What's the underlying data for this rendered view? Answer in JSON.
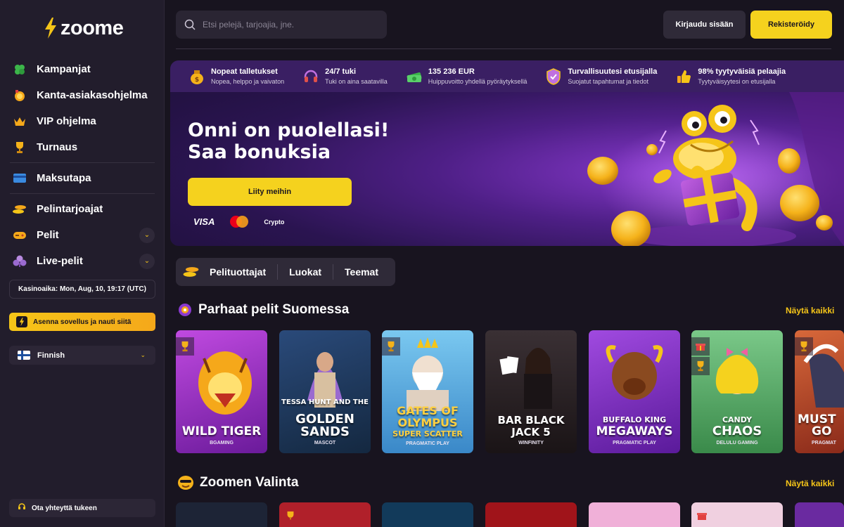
{
  "logo": {
    "text": "zoome"
  },
  "sidebar": {
    "items": [
      {
        "label": "Kampanjat",
        "icon": "clover-icon"
      },
      {
        "label": "Kanta-asiakasohjelma",
        "icon": "loyalty-coin-icon"
      },
      {
        "label": "VIP ohjelma",
        "icon": "crown-icon"
      },
      {
        "label": "Turnaus",
        "icon": "trophy-icon"
      },
      {
        "label": "Maksutapa",
        "icon": "card-icon"
      },
      {
        "label": "Pelintarjoajat",
        "icon": "providers-icon"
      },
      {
        "label": "Pelit",
        "icon": "gamepad-icon"
      },
      {
        "label": "Live-pelit",
        "icon": "clubs-icon"
      }
    ],
    "casino_time": "Kasinoaika: Mon, Aug, 10, 19:17 (UTC)",
    "install_app": "Asenna sovellus ja nauti siitä",
    "language": "Finnish",
    "support": "Ota yhteyttä tukeen"
  },
  "header": {
    "search_placeholder": "Etsi pelejä, tarjoajia, jne.",
    "login": "Kirjaudu sisään",
    "register": "Rekisteröidy"
  },
  "banner": {
    "features": [
      {
        "title": "Nopeat talletukset",
        "subtitle": "Nopea, helppo ja vaivaton",
        "icon": "money-bag-icon"
      },
      {
        "title": "24/7 tuki",
        "subtitle": "Tuki on aina saatavilla",
        "icon": "headset-icon"
      },
      {
        "title": "135 236 EUR",
        "subtitle": "Huippuvoitto yhdellä pyöräytyksellä",
        "icon": "cash-stack-icon"
      },
      {
        "title": "Turvallisuutesi etusijalla",
        "subtitle": "Suojatut tapahtumat ja tiedot",
        "icon": "shield-icon"
      },
      {
        "title": "98% tyytyväisiä pelaajia",
        "subtitle": "Tyytyväisyytesi on etusijalla",
        "icon": "thumbs-up-icon"
      }
    ],
    "title_line1": "Onni on puolellasi!",
    "title_line2": "Saa bonuksia",
    "join": "Liity meihin",
    "payments": {
      "visa": "VISA",
      "crypto": "Crypto"
    }
  },
  "category_tabs": [
    "Pelituottajat",
    "Luokat",
    "Teemat"
  ],
  "sections": {
    "best": {
      "title": "Parhaat pelit Suomessa",
      "see_all": "Näytä kaikki"
    },
    "picks": {
      "title": "Zoomen Valinta",
      "see_all": "Näytä kaikki"
    }
  },
  "games": [
    {
      "name1": "WILD TIGER",
      "name2": "",
      "provider": "BGAMING",
      "color": "#a03ad0"
    },
    {
      "name1": "TESSA HUNT AND THE",
      "name2": "GOLDEN SANDS",
      "provider": "MASCOT",
      "color": "#1d3a64"
    },
    {
      "name1": "GATES OF OLYMPUS",
      "name2": "SUPER SCATTER",
      "provider": "PRAGMATIC PLAY",
      "color": "#4aa0d8"
    },
    {
      "name1": "BAR BLACK",
      "name2": "JACK 5",
      "provider": "WINFINITY",
      "color": "#2a2226"
    },
    {
      "name1": "BUFFALO KING",
      "name2": "MEGAWAYS",
      "provider": "PRAGMATIC PLAY",
      "color": "#8a3ac8"
    },
    {
      "name1": "CANDY",
      "name2": "CHAOS",
      "provider": "DELULU GAMING",
      "color": "#3a8a4a"
    },
    {
      "name1": "MUST",
      "name2": "GO",
      "provider": "PRAGMAT",
      "color": "#b8482a"
    }
  ]
}
